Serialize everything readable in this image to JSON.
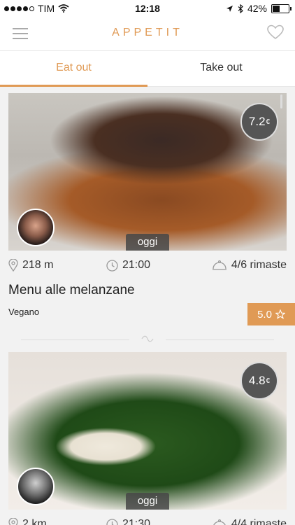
{
  "statusbar": {
    "carrier": "TIM",
    "time": "12:18",
    "battery": "42%"
  },
  "navbar": {
    "title": "APPETIT"
  },
  "tabs": [
    {
      "label": "Eat out",
      "active": true
    },
    {
      "label": "Take out",
      "active": false
    }
  ],
  "cards": [
    {
      "price": "7.2",
      "currency": "€",
      "day": "oggi",
      "distance": "218 m",
      "time": "21:00",
      "seats": "4/6 rimaste",
      "title": "Menu alle melanzane",
      "category": "Vegano",
      "rating": "5.0"
    },
    {
      "price": "4.8",
      "currency": "€",
      "day": "oggi",
      "distance": "2 km",
      "time": "21:30",
      "seats": "4/4 rimaste"
    }
  ],
  "colors": {
    "accent": "#e09a55",
    "text": "#222222"
  },
  "icons": {
    "menu": "hamburger-icon",
    "favorite": "heart-icon",
    "location": "pin-icon",
    "clock": "clock-icon",
    "seats": "cloche-icon",
    "rating": "star-icon"
  }
}
